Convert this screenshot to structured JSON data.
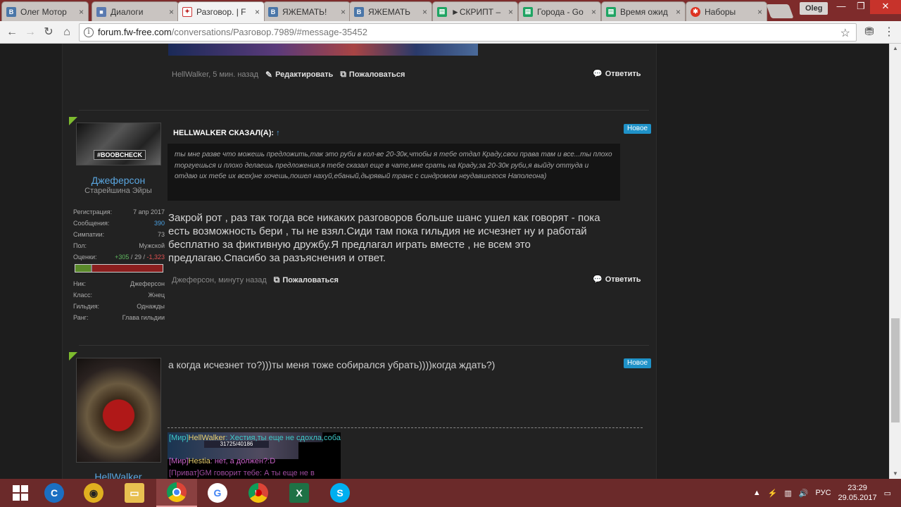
{
  "browser": {
    "tabs": [
      {
        "label": "Олег Мотор",
        "icon": "vk-icon"
      },
      {
        "label": "Диалоги",
        "icon": "chat-icon"
      },
      {
        "label": "Разговор. | F",
        "icon": "forum-icon",
        "active": true
      },
      {
        "label": "ЯЖЕМАТЬ!",
        "icon": "vk-icon"
      },
      {
        "label": "ЯЖЕМАТЬ",
        "icon": "vk-icon"
      },
      {
        "label": "►СКРИПТ –",
        "icon": "sheet-icon"
      },
      {
        "label": "Города - Go",
        "icon": "sheet-icon"
      },
      {
        "label": "Время ожид",
        "icon": "sheet-icon"
      },
      {
        "label": "Наборы",
        "icon": "red-icon"
      }
    ],
    "profile_name": "Oleg",
    "url_host": "forum.fw-free.com",
    "url_path": "/conversations/Разговор.7989/#message-35452"
  },
  "posts": {
    "top_footer": {
      "meta": "HellWalker, 5 мин. назад",
      "edit_label": "Редактировать",
      "report_label": "Пожаловаться",
      "reply_label": "Ответить"
    },
    "post1": {
      "badge": "Новое",
      "author": {
        "name": "Джеферсон",
        "title": "Старейшина Эйры",
        "avatar_text": "#BOOBCHECK"
      },
      "stats": [
        {
          "label": "Регистрация:",
          "value": "7 апр 2017"
        },
        {
          "label": "Сообщения:",
          "value": "390"
        },
        {
          "label": "Симпатии:",
          "value": "73"
        },
        {
          "label": "Пол:",
          "value": "Мужской"
        }
      ],
      "ratings": {
        "label": "Оценки:",
        "pos": "+305",
        "neutral": "29",
        "neg": "-1,323",
        "positive_fraction": 0.18,
        "neutral_fraction": 0.02
      },
      "game_info": [
        {
          "label": "Ник:",
          "value": "Джеферсон"
        },
        {
          "label": "Класс:",
          "value": "Жнец"
        },
        {
          "label": "Гильдия:",
          "value": "Однажды"
        },
        {
          "label": "Ранг:",
          "value": "Глава гильдии"
        }
      ],
      "quote_header": "HELLWALKER СКАЗАЛ(А):",
      "quote_arrow": "↑",
      "quote_text": "ты мне разве что можешь предложить,так это руби в кол-ве 20-30к,чтобы я тебе отдал Краду,свои права там и все...ты плохо торгуешься и плохо делаешь предложения,я тебе сказал еще в чате,мне срать на Краду,за 20-30к руби,я выйду оттуда и отдаю их тебе их всех)не хочешь,пошел нахуй,ебаный,дырявый транс с синдромом неудавшегося Наполеона)",
      "body": "Закрой рот , раз так тогда все никаких разговоров больше шанс ушел как говорят - пока есть возможность бери , ты не взял.Сиди там пока гильдия не исчезнет ну и работай бесплатно за фиктивную дружбу.Я предлагал играть вместе , не всем это предлагаю.Спасибо за разъяснения и ответ.",
      "meta": "Джеферсон, минуту назад",
      "report_label": "Пожаловаться",
      "reply_label": "Ответить"
    },
    "post2": {
      "badge": "Новое",
      "author": {
        "name": "HellWalker"
      },
      "body": "а когда исчезнет то?)))ты меня тоже собирался убрать))))когда ждать?)",
      "game_chat": {
        "line1_channel": "[Мир]",
        "line1_name": "HellWalker",
        "line1_text": ": Хестия,ты еще не сдохла,собака?)",
        "hp_text": "31725/40186",
        "line2_channel": "[Мир]",
        "line2_name": "Hestia",
        "line2_text": ": нет, а должен?:D",
        "line3_text": "[Приват]GM говорит тебе: А ты еще не в"
      }
    }
  },
  "taskbar": {
    "language": "РУС",
    "time": "23:29",
    "date": "29.05.2017"
  }
}
